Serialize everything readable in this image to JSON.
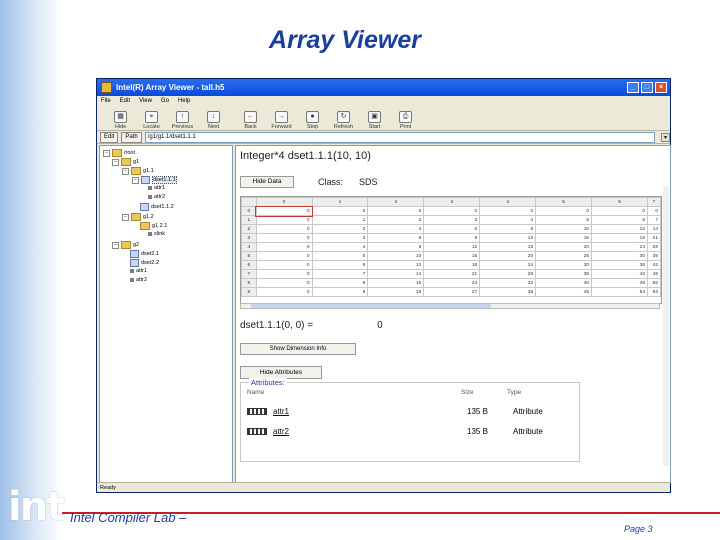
{
  "slide": {
    "title": "Array Viewer",
    "footer": "Intel Compiler Lab –",
    "page": "Page 3",
    "logo_text": "int",
    "accent_color": "#1a3f9c",
    "rule_color": "#c51f26"
  },
  "window": {
    "title": "Intel(R) Array Viewer - tall.h5",
    "menu": [
      "File",
      "Edit",
      "View",
      "Go",
      "Help"
    ],
    "toolbar": [
      {
        "label": "Hide",
        "icon": "grid-icon"
      },
      {
        "label": "Locate",
        "icon": "locate-icon"
      },
      {
        "label": "Previous",
        "icon": "up-arrow-icon"
      },
      {
        "label": "Next",
        "icon": "down-arrow-icon"
      },
      {
        "label": "Back",
        "icon": "back-arrow-icon"
      },
      {
        "label": "Forward",
        "icon": "forward-arrow-icon"
      },
      {
        "label": "Stop",
        "icon": "stop-icon"
      },
      {
        "label": "Refresh",
        "icon": "refresh-icon"
      },
      {
        "label": "Start",
        "icon": "start-icon"
      },
      {
        "label": "Print",
        "icon": "print-icon"
      }
    ],
    "address": {
      "edit_label": "Edit",
      "path_label": "Path",
      "path_value": "/g1/g1.1/dset1.1.1"
    },
    "status": "Ready"
  },
  "tree": [
    {
      "label": "/root",
      "kind": "folder"
    },
    {
      "label": "g1",
      "kind": "folder"
    },
    {
      "label": "g1.1",
      "kind": "folder"
    },
    {
      "label": "dset1.1.1",
      "kind": "dataset"
    },
    {
      "label": "attr1",
      "kind": "attribute"
    },
    {
      "label": "attr2",
      "kind": "attribute"
    },
    {
      "label": "dset1.1.2",
      "kind": "dataset"
    },
    {
      "label": "g1.2",
      "kind": "folder"
    },
    {
      "label": "g1.2.1",
      "kind": "folder"
    },
    {
      "label": "slink",
      "kind": "link"
    },
    {
      "label": "g2",
      "kind": "folder"
    },
    {
      "label": "dset2.1",
      "kind": "dataset"
    },
    {
      "label": "dset2.2",
      "kind": "dataset"
    },
    {
      "label": "attr1",
      "kind": "attribute"
    },
    {
      "label": "attr2",
      "kind": "attribute"
    }
  ],
  "dataset": {
    "title": "Integer*4 dset1.1.1(10, 10)",
    "hide_button": "Hide Data",
    "class_label": "Class:",
    "class_value": "SDS",
    "columns": [
      "0",
      "1",
      "2",
      "3",
      "4",
      "5",
      "6",
      "7"
    ],
    "rows": [
      {
        "idx": "0",
        "vals": [
          "0",
          "0",
          "0",
          "0",
          "0",
          "0",
          "0",
          "0"
        ]
      },
      {
        "idx": "1",
        "vals": [
          "0",
          "1",
          "2",
          "3",
          "4",
          "5",
          "6",
          "7"
        ]
      },
      {
        "idx": "2",
        "vals": [
          "0",
          "2",
          "4",
          "6",
          "8",
          "10",
          "12",
          "14"
        ]
      },
      {
        "idx": "3",
        "vals": [
          "0",
          "3",
          "6",
          "9",
          "12",
          "15",
          "18",
          "21"
        ]
      },
      {
        "idx": "4",
        "vals": [
          "0",
          "4",
          "8",
          "12",
          "16",
          "20",
          "24",
          "28"
        ]
      },
      {
        "idx": "5",
        "vals": [
          "0",
          "5",
          "10",
          "15",
          "20",
          "25",
          "30",
          "35"
        ]
      },
      {
        "idx": "6",
        "vals": [
          "0",
          "6",
          "12",
          "18",
          "24",
          "30",
          "36",
          "42"
        ]
      },
      {
        "idx": "7",
        "vals": [
          "0",
          "7",
          "14",
          "21",
          "28",
          "35",
          "42",
          "49"
        ]
      },
      {
        "idx": "8",
        "vals": [
          "0",
          "8",
          "16",
          "24",
          "32",
          "40",
          "48",
          "56"
        ]
      },
      {
        "idx": "9",
        "vals": [
          "0",
          "9",
          "18",
          "27",
          "36",
          "45",
          "54",
          "63"
        ]
      }
    ],
    "cell_label": "dset1.1.1(0, 0) =",
    "cell_value": "0",
    "dim_button": "Show Dimension Info",
    "attr_button": "Hide Attributes",
    "attributes": {
      "legend": "Attributes:",
      "headers": {
        "name": "Name",
        "size": "Size",
        "type": "Type"
      },
      "items": [
        {
          "name": "attr1",
          "size": "135 B",
          "type": "Attribute"
        },
        {
          "name": "attr2",
          "size": "135 B",
          "type": "Attribute"
        }
      ]
    }
  }
}
